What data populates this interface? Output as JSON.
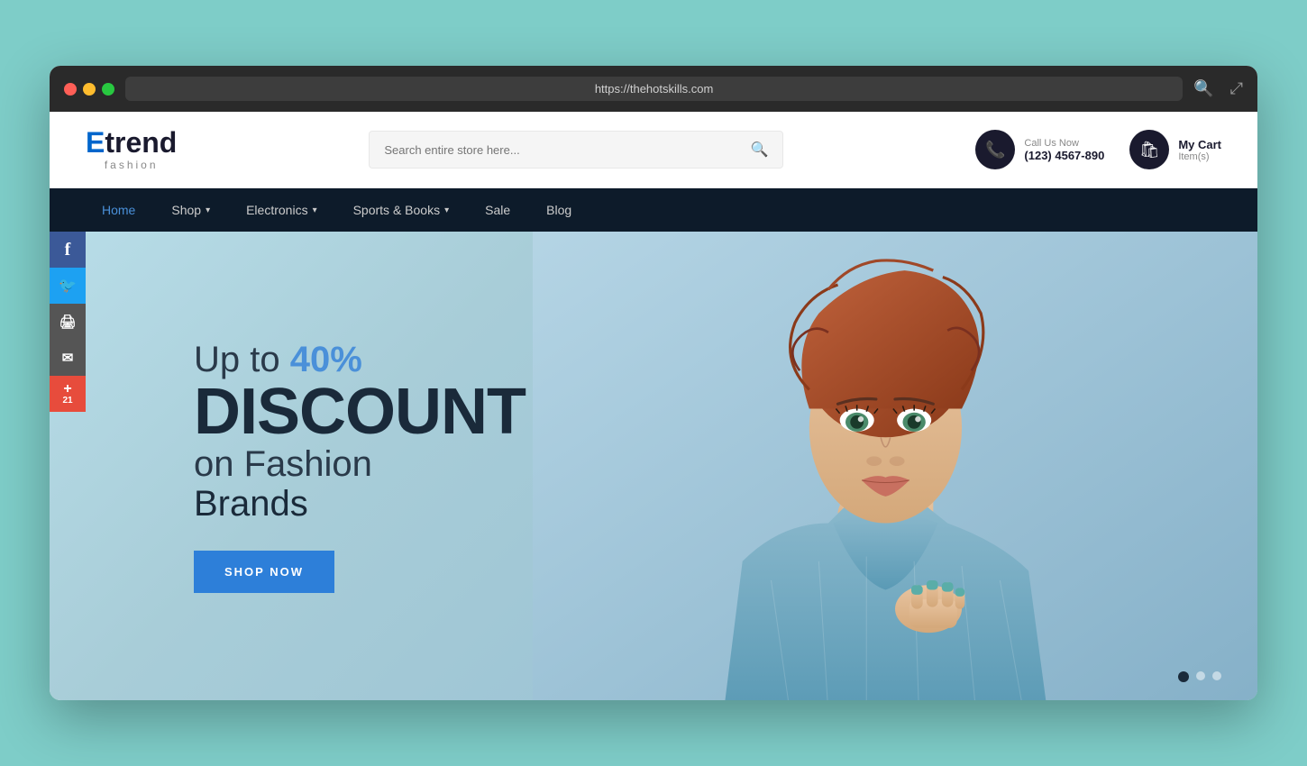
{
  "browser": {
    "url": "https://thehotskills.com",
    "dots": [
      "red",
      "yellow",
      "green"
    ]
  },
  "header": {
    "logo": {
      "brand": "Etrend",
      "sub": "fashion"
    },
    "search": {
      "placeholder": "Search entire store here..."
    },
    "contact": {
      "label": "Call Us Now",
      "number": "(123) 4567-890"
    },
    "cart": {
      "label": "My Cart",
      "items": "Item(s)"
    }
  },
  "nav": {
    "items": [
      {
        "label": "Home",
        "active": true,
        "has_dropdown": false
      },
      {
        "label": "Shop",
        "active": false,
        "has_dropdown": true
      },
      {
        "label": "Electronics",
        "active": false,
        "has_dropdown": true
      },
      {
        "label": "Sports & Books",
        "active": false,
        "has_dropdown": true
      },
      {
        "label": "Sale",
        "active": false,
        "has_dropdown": false
      },
      {
        "label": "Blog",
        "active": false,
        "has_dropdown": false
      }
    ]
  },
  "social": {
    "items": [
      {
        "label": "f",
        "name": "facebook",
        "color": "#3b5998"
      },
      {
        "label": "🐦",
        "name": "twitter",
        "color": "#1da1f2"
      },
      {
        "label": "🖨",
        "name": "print",
        "color": "#555"
      },
      {
        "label": "✉",
        "name": "email",
        "color": "#555"
      },
      {
        "label": "+",
        "sublabel": "21",
        "name": "plus",
        "color": "#e74c3c"
      }
    ]
  },
  "hero": {
    "line1": "Up to ",
    "percent": "40%",
    "line2": "DISCOUNT",
    "line3": "on Fashion",
    "line4": "Brands",
    "cta": "SHOP NOW",
    "slider_dots": [
      true,
      false,
      false
    ]
  }
}
